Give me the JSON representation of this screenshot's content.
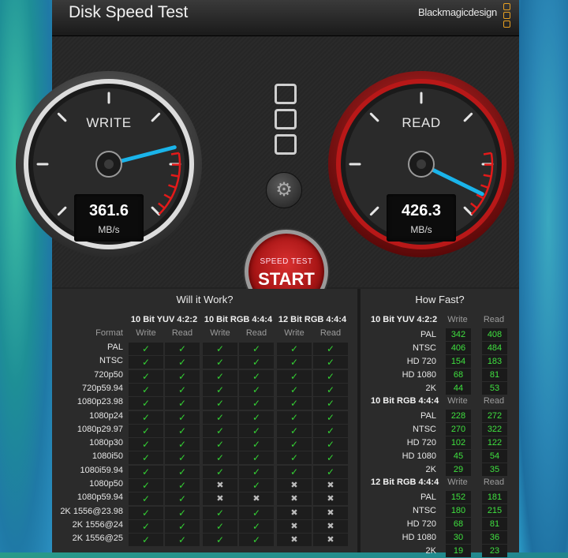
{
  "window": {
    "title": "Disk Speed Test",
    "brand": "Blackmagicdesign"
  },
  "write_gauge": {
    "label": "WRITE",
    "value": "361.6",
    "unit": "MB/s",
    "needle_fraction": 0.78
  },
  "read_gauge": {
    "label": "READ",
    "value": "426.3",
    "unit": "MB/s",
    "needle_fraction": 0.93
  },
  "controls": {
    "settings_icon": "gear-icon",
    "start_sub": "SPEED TEST",
    "start_main": "START"
  },
  "colors": {
    "accent_blue": "#1ab4ea",
    "start_red": "#c01d1d",
    "ok_green": "#34d234",
    "value_green": "#3fe03f"
  },
  "will_it_work": {
    "title": "Will it Work?",
    "format_header": "Format",
    "groups": [
      "10 Bit YUV 4:2:2",
      "10 Bit RGB 4:4:4",
      "12 Bit RGB 4:4:4"
    ],
    "sub_headers": [
      "Write",
      "Read"
    ],
    "rows": [
      {
        "format": "PAL",
        "marks": [
          "ok",
          "ok",
          "ok",
          "ok",
          "ok",
          "ok"
        ]
      },
      {
        "format": "NTSC",
        "marks": [
          "ok",
          "ok",
          "ok",
          "ok",
          "ok",
          "ok"
        ]
      },
      {
        "format": "720p50",
        "marks": [
          "ok",
          "ok",
          "ok",
          "ok",
          "ok",
          "ok"
        ]
      },
      {
        "format": "720p59.94",
        "marks": [
          "ok",
          "ok",
          "ok",
          "ok",
          "ok",
          "ok"
        ]
      },
      {
        "format": "1080p23.98",
        "marks": [
          "ok",
          "ok",
          "ok",
          "ok",
          "ok",
          "ok"
        ]
      },
      {
        "format": "1080p24",
        "marks": [
          "ok",
          "ok",
          "ok",
          "ok",
          "ok",
          "ok"
        ]
      },
      {
        "format": "1080p29.97",
        "marks": [
          "ok",
          "ok",
          "ok",
          "ok",
          "ok",
          "ok"
        ]
      },
      {
        "format": "1080p30",
        "marks": [
          "ok",
          "ok",
          "ok",
          "ok",
          "ok",
          "ok"
        ]
      },
      {
        "format": "1080i50",
        "marks": [
          "ok",
          "ok",
          "ok",
          "ok",
          "ok",
          "ok"
        ]
      },
      {
        "format": "1080i59.94",
        "marks": [
          "ok",
          "ok",
          "ok",
          "ok",
          "ok",
          "ok"
        ]
      },
      {
        "format": "1080p50",
        "marks": [
          "ok",
          "ok",
          "no",
          "ok",
          "no",
          "no"
        ]
      },
      {
        "format": "1080p59.94",
        "marks": [
          "ok",
          "ok",
          "no",
          "no",
          "no",
          "no"
        ]
      },
      {
        "format": "2K 1556@23.98",
        "marks": [
          "ok",
          "ok",
          "ok",
          "ok",
          "no",
          "no"
        ]
      },
      {
        "format": "2K 1556@24",
        "marks": [
          "ok",
          "ok",
          "ok",
          "ok",
          "no",
          "no"
        ]
      },
      {
        "format": "2K 1556@25",
        "marks": [
          "ok",
          "ok",
          "ok",
          "ok",
          "no",
          "no"
        ]
      }
    ]
  },
  "how_fast": {
    "title": "How Fast?",
    "sub_headers": [
      "Write",
      "Read"
    ],
    "groups": [
      {
        "name": "10 Bit YUV 4:2:2",
        "rows": [
          {
            "format": "PAL",
            "write": "342",
            "read": "408"
          },
          {
            "format": "NTSC",
            "write": "406",
            "read": "484"
          },
          {
            "format": "HD 720",
            "write": "154",
            "read": "183"
          },
          {
            "format": "HD 1080",
            "write": "68",
            "read": "81"
          },
          {
            "format": "2K",
            "write": "44",
            "read": "53"
          }
        ]
      },
      {
        "name": "10 Bit RGB 4:4:4",
        "rows": [
          {
            "format": "PAL",
            "write": "228",
            "read": "272"
          },
          {
            "format": "NTSC",
            "write": "270",
            "read": "322"
          },
          {
            "format": "HD 720",
            "write": "102",
            "read": "122"
          },
          {
            "format": "HD 1080",
            "write": "45",
            "read": "54"
          },
          {
            "format": "2K",
            "write": "29",
            "read": "35"
          }
        ]
      },
      {
        "name": "12 Bit RGB 4:4:4",
        "rows": [
          {
            "format": "PAL",
            "write": "152",
            "read": "181"
          },
          {
            "format": "NTSC",
            "write": "180",
            "read": "215"
          },
          {
            "format": "HD 720",
            "write": "68",
            "read": "81"
          },
          {
            "format": "HD 1080",
            "write": "30",
            "read": "36"
          },
          {
            "format": "2K",
            "write": "19",
            "read": "23"
          }
        ]
      }
    ]
  }
}
